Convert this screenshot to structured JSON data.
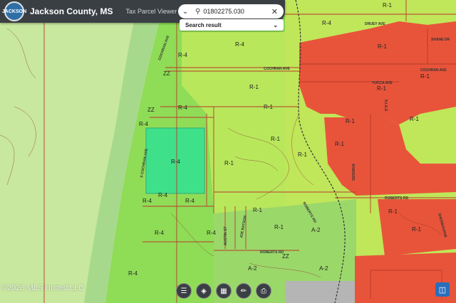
{
  "header": {
    "title": "Jackson County, MS",
    "subtitle": "Tax Parcel Viewer",
    "logo_text": "JACKSON"
  },
  "search": {
    "value": "01802275.030",
    "result_label": "Search result"
  },
  "toolbar": {
    "items": [
      "layers-list-icon",
      "layers-stack-icon",
      "basemap-grid-icon",
      "measure-icon",
      "print-icon"
    ]
  },
  "watermark": "©2026 MLS United LLC",
  "map": {
    "zone_labels": [
      "R-4",
      "R-4",
      "R-4",
      "R-4",
      "R-1",
      "R-1",
      "R-4",
      "R-4",
      "R-4",
      "R-1",
      "R-1",
      "R-4",
      "R-4",
      "R-1",
      "R-1",
      "A-2",
      "A-2",
      "R-1",
      "R-1",
      "R-1",
      "R-1",
      "R-1",
      "R-1",
      "R-4",
      "R-4",
      "R-4",
      "ZZ",
      "ZZ",
      "ZZ",
      "A-2",
      "R-1",
      "R-1",
      "R-1",
      "R-1"
    ],
    "street_labels": [
      "COCHRAN AVE",
      "COCHRAN AVE",
      "COCHRAN AVE",
      "S COCHRAN AVE",
      "YUCCA AVE",
      "DRUEY AVE",
      "SHANE DR",
      "ROBERTS RD",
      "ROBERTS RD",
      "ROBERTS RD",
      "SHAVERS",
      "SHERBOURNE",
      "AUSTIN ST",
      "JOE BATSON",
      "N.I.A.D"
    ],
    "colors": {
      "r4": "#7bd44b",
      "r1": "#c3e85a",
      "a2": "#9bd86a",
      "commercial": "#e8543a",
      "selected": "#3fe08a",
      "river": "#b9dea0",
      "outer": "#cfe9a8",
      "parcel_line": "#c0392b"
    }
  }
}
